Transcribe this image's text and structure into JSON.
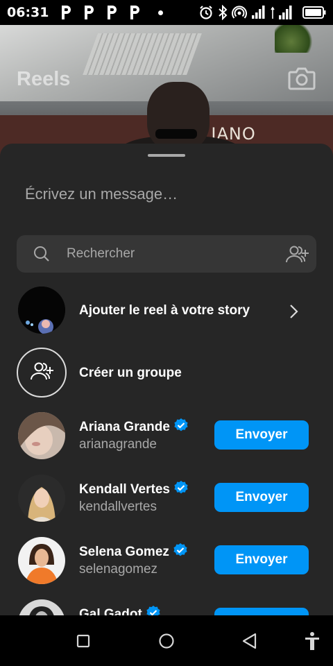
{
  "status_bar": {
    "time": "06:31",
    "notification_icons": [
      "p-icon",
      "p-icon",
      "p-icon",
      "p-icon"
    ],
    "right_icons": [
      "alarm-icon",
      "bluetooth-icon",
      "hotspot-icon",
      "signal-icon",
      "signal-4g-icon",
      "battery-icon"
    ]
  },
  "reel": {
    "title": "Reels",
    "background_sign": "LIANO"
  },
  "sheet": {
    "message_placeholder": "Écrivez un message…",
    "search_placeholder": "Rechercher"
  },
  "actions": {
    "story_label": "Ajouter le reel à votre story",
    "group_label": "Créer un groupe"
  },
  "contacts": [
    {
      "name": "Ariana Grande",
      "username": "arianagrande",
      "verified": true,
      "button_label": "Envoyer"
    },
    {
      "name": "Kendall Vertes",
      "username": "kendallvertes",
      "verified": true,
      "button_label": "Envoyer"
    },
    {
      "name": "Selena Gomez",
      "username": "selenagomez",
      "verified": true,
      "button_label": "Envoyer"
    },
    {
      "name": "Gal Gadot",
      "username": "",
      "verified": true,
      "button_label": ""
    }
  ],
  "colors": {
    "sheet_bg": "#262626",
    "search_bg": "#363636",
    "accent_blue": "#0095f6",
    "secondary_text": "#a8a8a8"
  }
}
